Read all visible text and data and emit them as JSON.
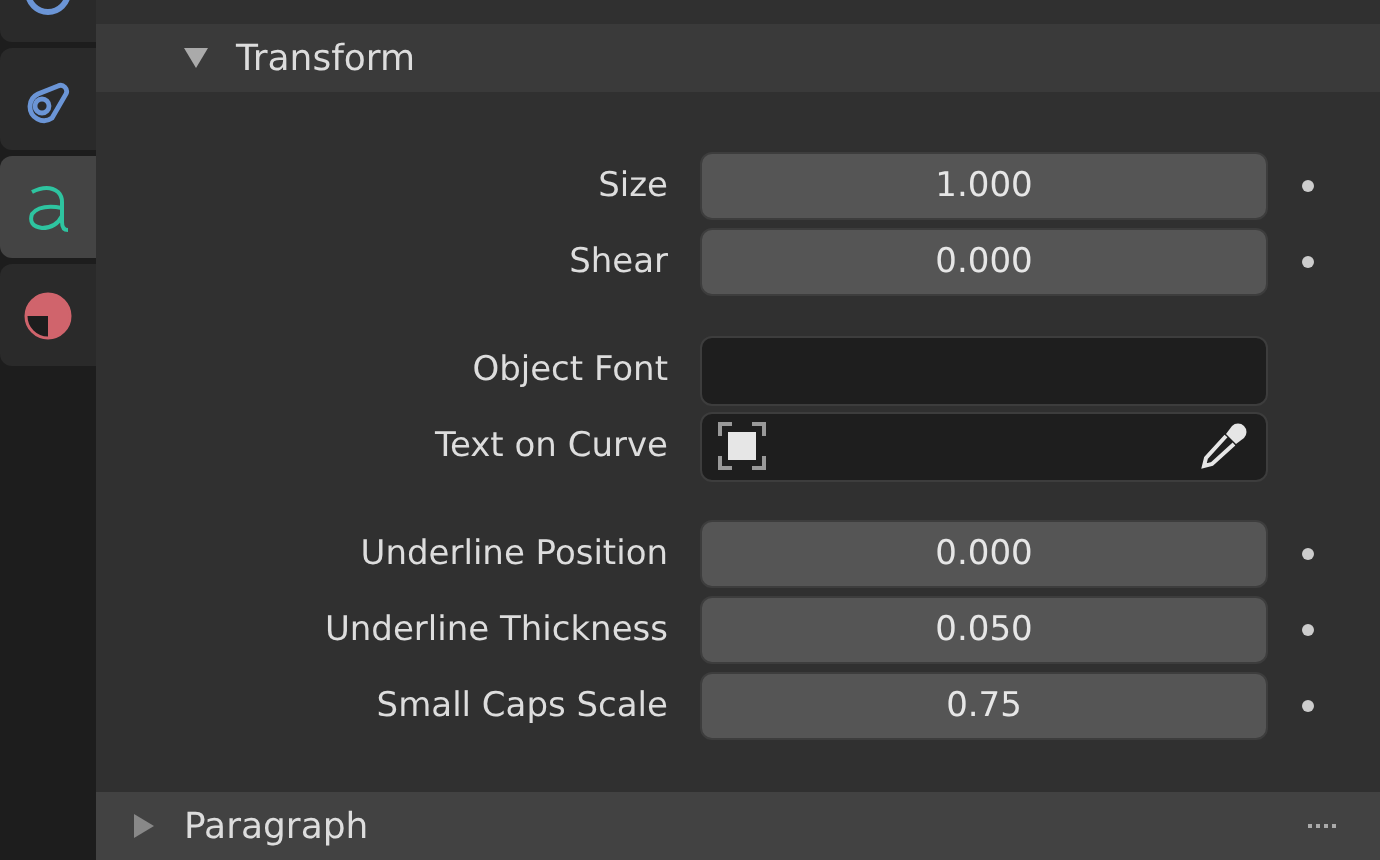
{
  "sidebar": {
    "tabs": [
      {
        "kind": "partial",
        "selected": false
      },
      {
        "kind": "constraint",
        "selected": false
      },
      {
        "kind": "text",
        "selected": true
      },
      {
        "kind": "material",
        "selected": false
      }
    ]
  },
  "panels": [
    {
      "title": "Transform",
      "expanded": true,
      "groups": [
        [
          {
            "label": "Size",
            "kind": "number",
            "value": "1.000",
            "animatable": true
          },
          {
            "label": "Shear",
            "kind": "number",
            "value": "0.000",
            "animatable": true
          }
        ],
        [
          {
            "label": "Object Font",
            "kind": "font",
            "animatable": false
          },
          {
            "label": "Text on Curve",
            "kind": "object",
            "animatable": false
          }
        ],
        [
          {
            "label": "Underline Position",
            "kind": "number",
            "value": "0.000",
            "animatable": true
          },
          {
            "label": "Underline Thickness",
            "kind": "number",
            "value": "0.050",
            "animatable": true
          },
          {
            "label": "Small Caps Scale",
            "kind": "number",
            "value": "0.75",
            "animatable": true
          }
        ]
      ]
    },
    {
      "title": "Paragraph",
      "expanded": false
    }
  ]
}
